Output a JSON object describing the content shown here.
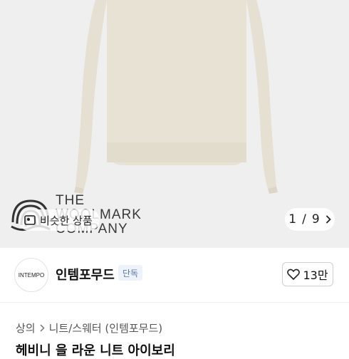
{
  "product_image": {
    "brand_logo_text": [
      "THE",
      "WOOLMARK",
      "COMPANY"
    ],
    "similar_button_label": "비슷한 상품",
    "pager": {
      "current": "1",
      "separator": "/",
      "total": "9"
    }
  },
  "shop": {
    "logo_text": "INTEMPO",
    "name": "인템포무드",
    "badge": "단독",
    "likes": "13만"
  },
  "breadcrumb": {
    "level1": "상의",
    "level2": "니트/스웨터 (인템포무드)"
  },
  "product": {
    "title_partial": "헤비니 을 라운 니트 아이보리"
  },
  "colors": {
    "hero_bg": "#efefef",
    "sweater": "#e9e3d5",
    "badge_bg": "#eef3fb",
    "badge_text": "#5a77a6"
  }
}
